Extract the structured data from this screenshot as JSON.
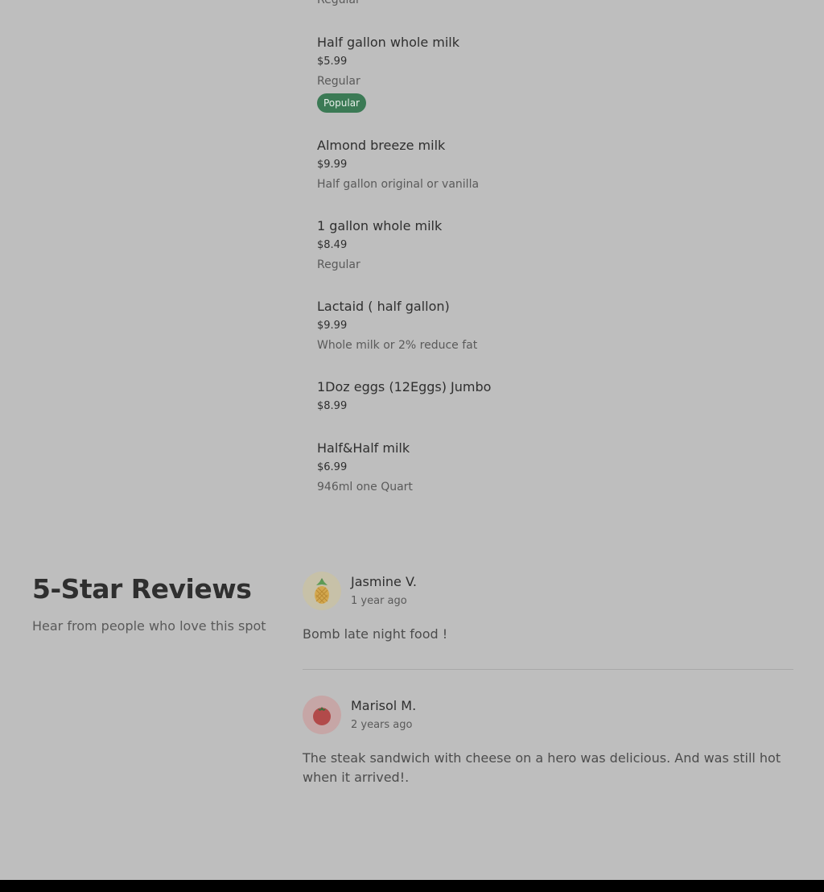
{
  "menu": {
    "cut_item_desc": "Regular",
    "items": [
      {
        "name": "Half gallon whole milk",
        "price": "$5.99",
        "desc": "Regular",
        "badge": "Popular"
      },
      {
        "name": "Almond breeze milk",
        "price": "$9.99",
        "desc": "Half gallon original or vanilla"
      },
      {
        "name": "1 gallon whole milk",
        "price": "$8.49",
        "desc": "Regular"
      },
      {
        "name": "Lactaid ( half gallon)",
        "price": "$9.99",
        "desc": "Whole milk or 2% reduce fat"
      },
      {
        "name": "1Doz eggs (12Eggs) Jumbo",
        "price": "$8.99"
      },
      {
        "name": "Half&Half milk",
        "price": "$6.99",
        "desc": "946ml one Quart"
      }
    ]
  },
  "reviews": {
    "title": "5-Star Reviews",
    "subtitle": "Hear from people who love this spot",
    "list": [
      {
        "name": "Jasmine V.",
        "time": "1 year ago",
        "text": "Bomb late night food !",
        "avatar_icon": "pineapple-icon"
      },
      {
        "name": "Marisol M.",
        "time": "2 years ago",
        "text": "The steak sandwich with cheese on a hero was delicious. And was still hot when it arrived!.",
        "avatar_icon": "tomato-icon"
      }
    ]
  },
  "colors": {
    "background": "#bebebe",
    "badge": "#3b7a55",
    "footer": "#000000"
  }
}
